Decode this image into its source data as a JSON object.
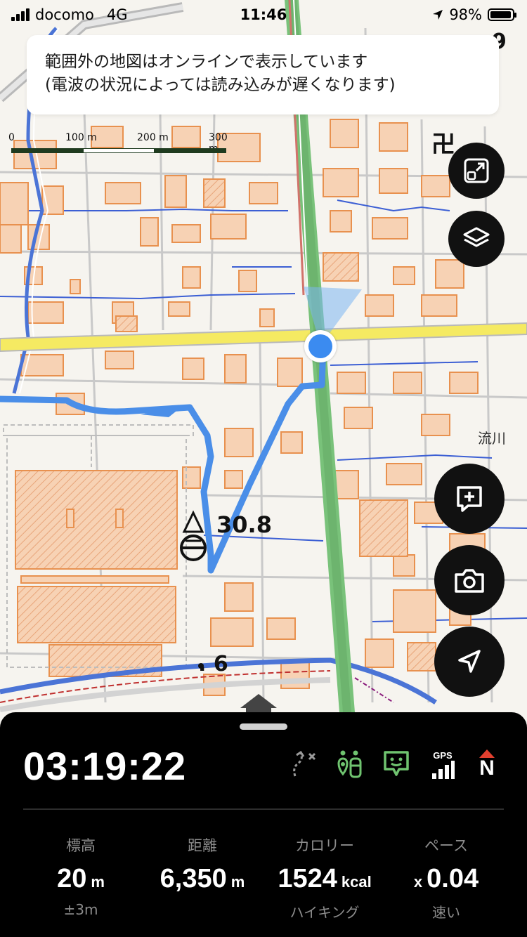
{
  "status_bar": {
    "carrier": "docomo",
    "network": "4G",
    "time": "11:46",
    "battery": "98%"
  },
  "banner": {
    "line1": "範囲外の地図はオンラインで表示しています",
    "line2": "(電波の状況によっては読み込みが遅くなります)"
  },
  "scale_bar": {
    "tick0": "0",
    "tick1": "100 m",
    "tick2": "200 m",
    "tick3": "300 m"
  },
  "map_labels": {
    "summit_elevation": "30.8",
    "small_elevation": ". 6",
    "river_name": "流川",
    "temple_symbol": "卍",
    "partial_corner_number": "9"
  },
  "colors": {
    "route": "#4a8ee8",
    "location_dot": "#3b8bf0",
    "road_yellow": "#f5ea62",
    "rail_green": "#79c27a",
    "building": "#f7d2b4",
    "building_outline": "#e8914f",
    "water": "#4b74d6"
  },
  "icons": {
    "map_fit": "map-fit-icon",
    "layers": "layers-icon",
    "add_memo": "add-memo-icon",
    "camera": "camera-icon",
    "current_location": "navigation-arrow-icon"
  },
  "panel": {
    "elapsed_time": "03:19:22",
    "gps_label": "GPS",
    "compass_label": "N",
    "stats": [
      {
        "label": "標高",
        "value": "20",
        "unit": "m",
        "sub": "±3m"
      },
      {
        "label": "距離",
        "value": "6,350",
        "unit": "m",
        "sub": ""
      },
      {
        "label": "カロリー",
        "value": "1524",
        "unit": "kcal",
        "sub": "ハイキング"
      },
      {
        "label": "ペース",
        "prefix": "x",
        "value": "0.04",
        "sub": "速い"
      }
    ]
  }
}
